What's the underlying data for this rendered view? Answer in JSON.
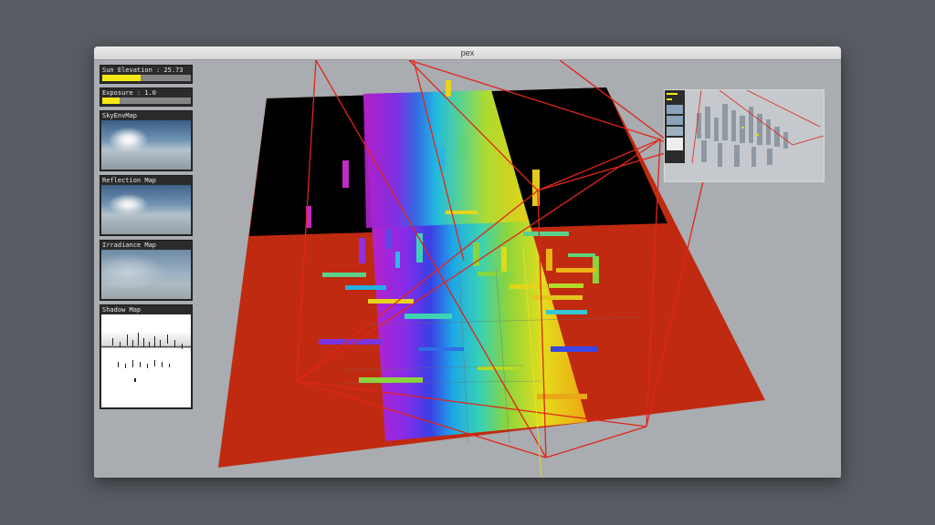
{
  "window": {
    "title": "pex"
  },
  "gui": {
    "sun_elevation": {
      "label": "Sun Elevation : 25.73",
      "fraction": 0.43
    },
    "exposure": {
      "label": "Exposure : 1.0",
      "fraction": 0.2
    },
    "panels": {
      "sky_env_map": "SkyEnvMap",
      "reflection_map": "Reflection Map",
      "irradiance_map": "Irradiance Map",
      "shadow_map": "Shadow Map"
    }
  },
  "colors": {
    "slider_fill": "#f5e912",
    "ground_lit": "#c02a10",
    "ground_shadow": "#000000",
    "frustum_lines": "#e0251a",
    "background": "#a9acb0"
  }
}
